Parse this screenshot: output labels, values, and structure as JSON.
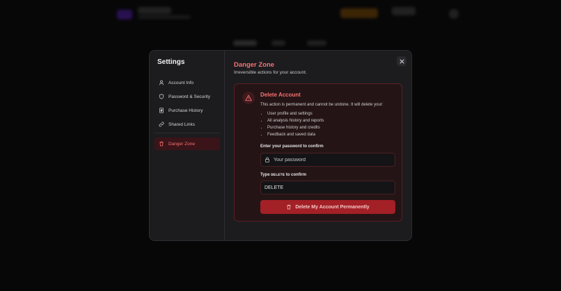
{
  "settings": {
    "title": "Settings",
    "nav": [
      {
        "label": "Account Info",
        "icon": "user-icon"
      },
      {
        "label": "Password & Security",
        "icon": "shield-icon"
      },
      {
        "label": "Purchase History",
        "icon": "receipt-icon"
      },
      {
        "label": "Shared Links",
        "icon": "link-icon"
      },
      {
        "label": "Danger Zone",
        "icon": "trash-icon",
        "active": true
      }
    ]
  },
  "danger_zone": {
    "title": "Danger Zone",
    "subtitle": "Irreversible actions for your account.",
    "card": {
      "title": "Delete Account",
      "description": "This action is permanent and cannot be undone. It will delete your:",
      "items": [
        "User profile and settings",
        "All analysis history and reports",
        "Purchase history and credits",
        "Feedback and saved data"
      ],
      "password_label": "Enter your password to confirm",
      "password_placeholder": "Your password",
      "confirm_label_prefix": "Type",
      "confirm_keyword": "DELETE",
      "confirm_label_suffix": "to confirm",
      "confirm_value": "DELETE",
      "delete_button": "Delete My Account Permanently"
    }
  },
  "colors": {
    "accent_danger": "#f87171",
    "button_danger": "#a32026",
    "modal_bg": "#1c1c1f"
  }
}
